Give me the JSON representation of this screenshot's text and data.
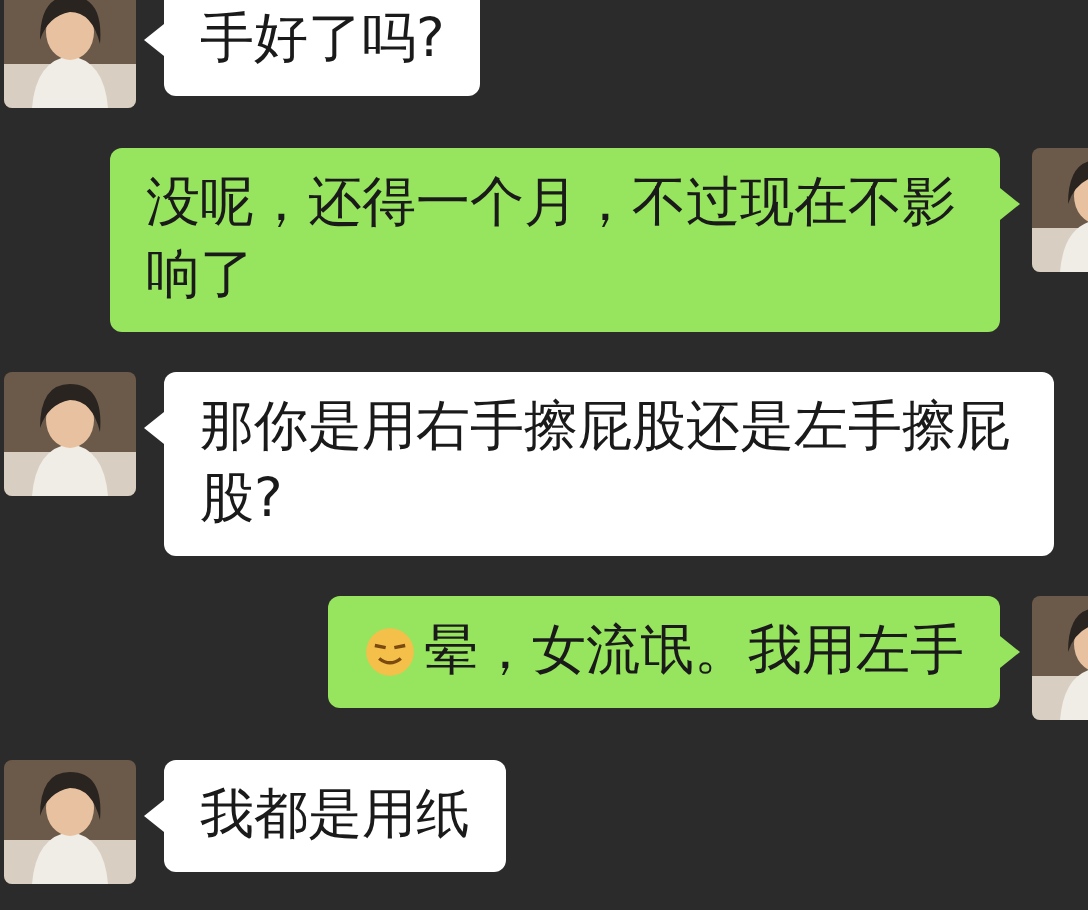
{
  "messages": [
    {
      "kind": "incoming",
      "text": "手好了吗?",
      "emoji": false
    },
    {
      "kind": "outgoing",
      "text": "没呢，还得一个月，不过现在不影响了",
      "emoji": false
    },
    {
      "kind": "incoming",
      "text": "那你是用右手擦屁股还是左手擦屁股?",
      "emoji": false
    },
    {
      "kind": "outgoing",
      "text": "晕，女流氓。我用左手",
      "emoji": true
    },
    {
      "kind": "incoming",
      "text": "我都是用纸",
      "emoji": false
    }
  ]
}
